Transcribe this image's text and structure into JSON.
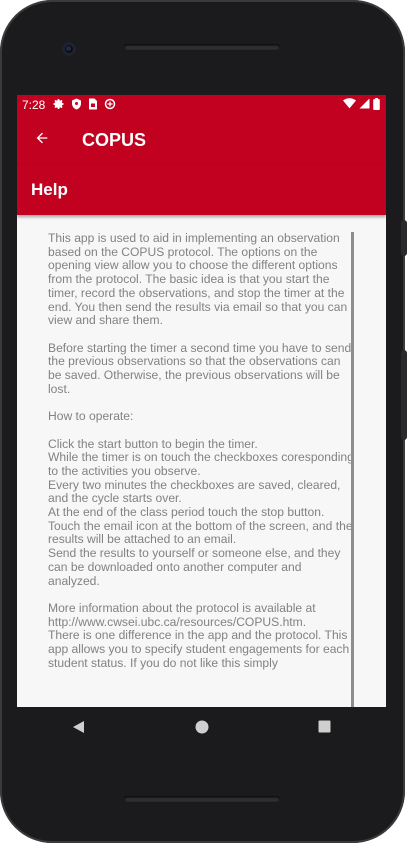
{
  "status_bar": {
    "time": "7:28",
    "left_icons": [
      "gear-icon",
      "shield-icon",
      "sim-card-icon",
      "data-saver-icon"
    ],
    "right_icons": [
      "wifi-icon",
      "signal-icon",
      "battery-icon"
    ]
  },
  "app_bar": {
    "title": "COPUS",
    "back_icon": "arrow-back-icon"
  },
  "section": {
    "title": "Help"
  },
  "help_text": "This app is used to aid in implementing an observation based on the COPUS protocol. The options on the opening view allow you to choose the different options from the protocol. The basic idea is that you start the timer, record the observations, and stop the timer at the end. You then send the results via email so that you can view and share them.\n\nBefore starting the timer a second time you have to send the previous observations so that the observations can be saved. Otherwise, the previous observations will be lost.\n\nHow to operate:\n\nClick the start button to begin the timer.\nWhile the timer is on touch the checkboxes coresponding to the activities you observe.\nEvery two minutes the checkboxes are saved, cleared, and the cycle starts over.\nAt the end of the class period touch the stop button.\nTouch the email icon at the bottom of the screen, and the results will be attached to an email.\nSend the results to yourself or someone else, and they can be downloaded onto another computer and analyzed.\n\nMore information about the protocol is available at http://www.cwsei.ubc.ca/resources/COPUS.htm.\nThere is one difference in the app and the protocol. This app allows you to specify student engagements for each student status. If you do not like this simply",
  "nav_bar": {
    "buttons": [
      "back-triangle-icon",
      "home-circle-icon",
      "recents-square-icon"
    ]
  },
  "colors": {
    "primary": "#c2001f",
    "text": "#828282",
    "background": "#f7f7f7"
  }
}
